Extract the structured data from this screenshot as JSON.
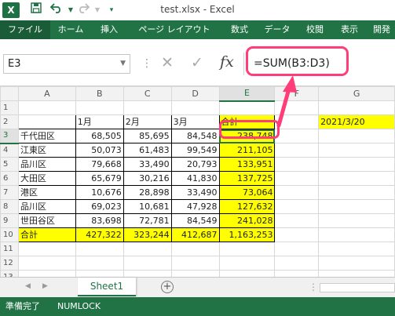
{
  "titlebar": {
    "app_icon": "X",
    "save_icon": "save-icon",
    "undo_icon": "undo-icon",
    "redo_icon": "redo-icon",
    "title": "test.xlsx - Excel"
  },
  "ribbon": {
    "tabs": [
      "ファイル",
      "ホーム",
      "挿入",
      "ページ レイアウト",
      "数式",
      "データ",
      "校閲",
      "表示",
      "開発"
    ],
    "color": "#217346"
  },
  "formula_bar": {
    "name_box": "E3",
    "formula": "=SUM(B3:D3)"
  },
  "grid": {
    "columns": [
      "A",
      "B",
      "C",
      "D",
      "E",
      "F",
      "G"
    ],
    "rows": [
      [
        "",
        "",
        "",
        "",
        "",
        "",
        ""
      ],
      [
        "",
        "1月",
        "2月",
        "3月",
        "合計",
        "",
        "2021/3/20"
      ],
      [
        "千代田区",
        "68,505",
        "85,695",
        "84,548",
        "238,748",
        "",
        ""
      ],
      [
        "江東区",
        "50,073",
        "61,483",
        "99,549",
        "211,105",
        "",
        ""
      ],
      [
        "品川区",
        "79,668",
        "33,490",
        "20,793",
        "133,951",
        "",
        ""
      ],
      [
        "大田区",
        "65,679",
        "30,216",
        "41,830",
        "137,725",
        "",
        ""
      ],
      [
        "港区",
        "10,676",
        "28,898",
        "33,490",
        "73,064",
        "",
        ""
      ],
      [
        "品川区",
        "69,023",
        "10,681",
        "47,928",
        "127,632",
        "",
        ""
      ],
      [
        "世田谷区",
        "83,698",
        "72,781",
        "84,549",
        "241,028",
        "",
        ""
      ],
      [
        "合計",
        "427,322",
        "323,244",
        "412,687",
        "1,163,253",
        "",
        ""
      ],
      [
        "",
        "",
        "",
        "",
        "",
        "",
        ""
      ],
      [
        "",
        "",
        "",
        "",
        "",
        "",
        ""
      ],
      [
        "",
        "",
        "",
        "",
        "",
        "",
        ""
      ]
    ],
    "active_cell": "E3",
    "highlight_color": "#ffff00"
  },
  "sheet_tabs": {
    "tabs": [
      "Sheet1"
    ],
    "add": "+"
  },
  "status_bar": {
    "ready": "準備完了",
    "numlock": "NUMLOCK"
  },
  "annotation_color": "#ff3d78"
}
